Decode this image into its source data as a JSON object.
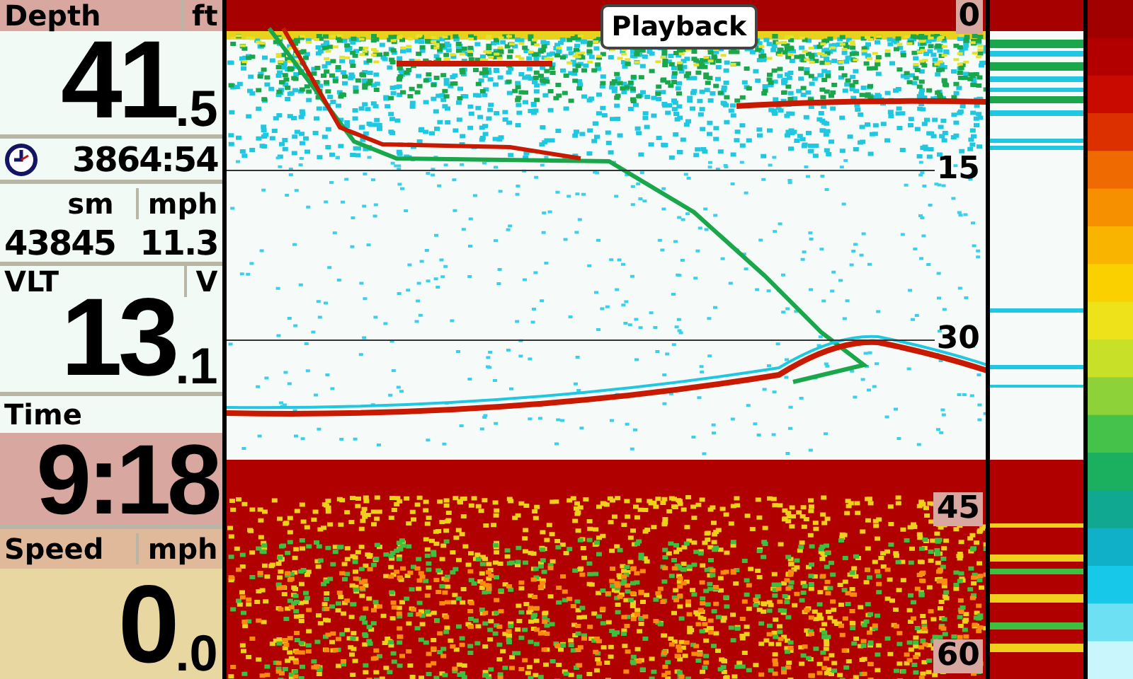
{
  "sidebar": {
    "depth": {
      "label": "Depth",
      "unit": "ft",
      "whole": "41",
      "fraction": ".5"
    },
    "timer": {
      "value": "3864:54"
    },
    "trip": {
      "units": [
        "sm",
        "mph"
      ],
      "values": [
        "43845",
        "11.3"
      ]
    },
    "voltage": {
      "label": "VLT",
      "unit": "V",
      "whole": "13",
      "fraction": ".1"
    },
    "time": {
      "label": "Time",
      "value": "9:18"
    },
    "speed": {
      "label": "Speed",
      "unit": "mph",
      "whole": "0",
      "fraction": ".0"
    }
  },
  "sonar": {
    "badge": "Playback",
    "depth_marks": [
      {
        "label": "0",
        "line": false
      },
      {
        "label": "15",
        "line": true
      },
      {
        "label": "30",
        "line": true
      },
      {
        "label": "45",
        "line": false
      },
      {
        "label": "60",
        "line": false
      }
    ]
  }
}
